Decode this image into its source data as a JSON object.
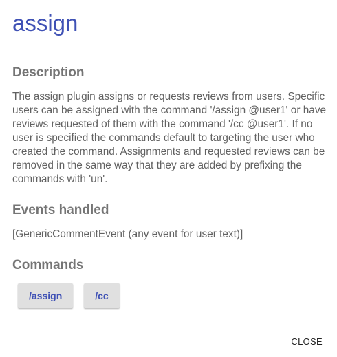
{
  "dialog": {
    "title": "assign",
    "description": {
      "heading": "Description",
      "text": "The assign plugin assigns or requests reviews from users. Specific users can be assigned with the command '/assign @user1' or have reviews requested of them with the command '/cc @user1'. If no user is specified the commands default to targeting the user who created the command. Assignments and requested reviews can be removed in the same way that they are added by prefixing the commands with 'un'."
    },
    "events": {
      "heading": "Events handled",
      "text": "[GenericCommentEvent (any event for user text)]"
    },
    "commands": {
      "heading": "Commands",
      "items": [
        "/assign",
        "/cc"
      ]
    },
    "close_label": "CLOSE"
  },
  "colors": {
    "title": "#3f51b5",
    "heading": "#757575",
    "body": "#616161",
    "chip_bg": "#e0e0e0"
  }
}
